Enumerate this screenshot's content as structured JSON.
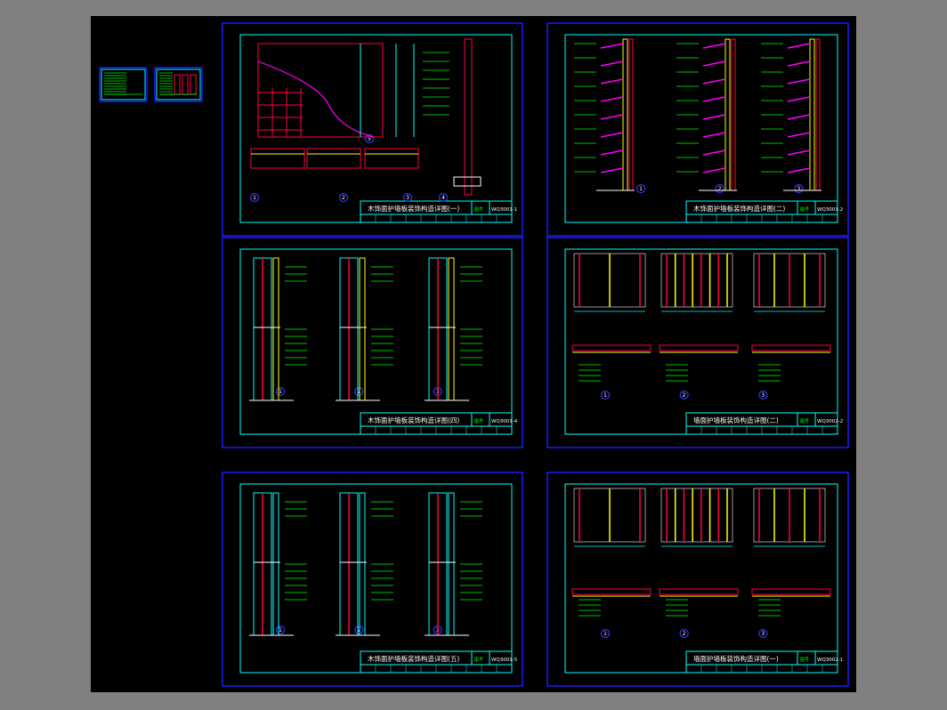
{
  "canvas": {
    "background": "#808080",
    "drawing_background": "#000000"
  },
  "colors": {
    "frame": "#1a1aff",
    "border": "#00ffff",
    "text": "#00ff00",
    "wall": "#ff0044",
    "accent_magenta": "#ff00ff",
    "accent_yellow": "#ffff00",
    "accent_cyan": "#00ffff",
    "accent_white": "#ffffff",
    "marker": "#3333ff"
  },
  "sheets": [
    {
      "id": "s1",
      "title": "木饰面护墙板装饰构造详图(一)",
      "code": "WQ3001-1",
      "detail_numbers": [
        "1",
        "2",
        "3",
        "4",
        "5"
      ]
    },
    {
      "id": "s2",
      "title": "木饰面护墙板装饰构造详图(二)",
      "code": "WQ3001-2",
      "detail_numbers": [
        "1",
        "2",
        "3"
      ]
    },
    {
      "id": "s3",
      "title": "木饰面护墙板装饰构造详图(四)",
      "code": "WQ3001-4",
      "detail_numbers": [
        "1",
        "2",
        "3"
      ]
    },
    {
      "id": "s4",
      "title": "墙面护墙板装饰构造详图(二)",
      "code": "WQ3002-2",
      "detail_numbers": [
        "1",
        "2",
        "3"
      ]
    },
    {
      "id": "s5",
      "title": "木饰面护墙板装饰构造详图(五)",
      "code": "WQ3001-5",
      "detail_numbers": [
        "1",
        "2",
        "3"
      ]
    },
    {
      "id": "s6",
      "title": "墙面护墙板装饰构造详图(一)",
      "code": "WQ3002-1",
      "detail_numbers": [
        "1",
        "2",
        "3"
      ]
    }
  ]
}
